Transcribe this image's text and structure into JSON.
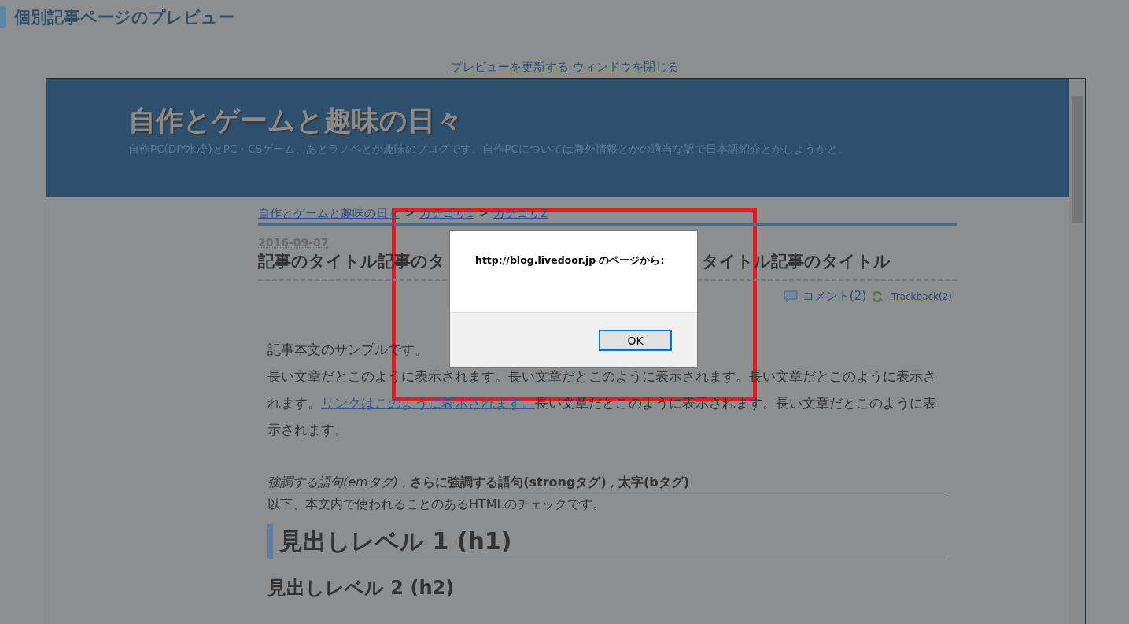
{
  "page_title": "個別記事ページのプレビュー",
  "preview_links": [
    {
      "label": "プレビューを更新する"
    },
    {
      "label": "ウィンドウを閉じる"
    }
  ],
  "blog": {
    "title": "自作とゲームと趣味の日々",
    "description": "自作PC(DIY水冷)とPC・CSゲーム、あとラノベとか趣味のブログです。自作PCについては海外情報とかの適当な訳で日本語紹介とかしようかと。"
  },
  "breadcrumb": {
    "separator": ">",
    "items": [
      "自作とゲームと趣味の日々",
      "カテゴリ1",
      "カテゴリ2"
    ]
  },
  "article": {
    "date": "2016-09-07",
    "title_parts": [
      "記事のタイトル記事のタ",
      "タイトル記事のタイトル"
    ],
    "comments_link": "コメント(2)",
    "trackback_link": "Trackback(2)",
    "intro": "記事本文のサンプルです。",
    "paragraph": {
      "before": "長い文章だとこのように表示されます。長い文章だとこのように表示されます。長い文章だとこのように表示されます。",
      "link": "リンクはこのように表示されます。",
      "after": "長い文章だとこのように表示されます。長い文章だとこのように表示されます。"
    },
    "emphasis_line": "*強調する語句(emタグ)* , **さらに強調する語句(strongタグ)** , **太字(bタグ)**",
    "html_check_note": "以下、本文内で使われることのあるHTMLのチェックです。",
    "headings": [
      {
        "kind": "h1",
        "text": "見出しレベル 1 (h1)"
      },
      {
        "kind": "h2",
        "text": "見出しレベル 2 (h2)"
      }
    ]
  },
  "dialog": {
    "message": "http://blog.livedoor.jp のページから:",
    "button": "OK"
  }
}
